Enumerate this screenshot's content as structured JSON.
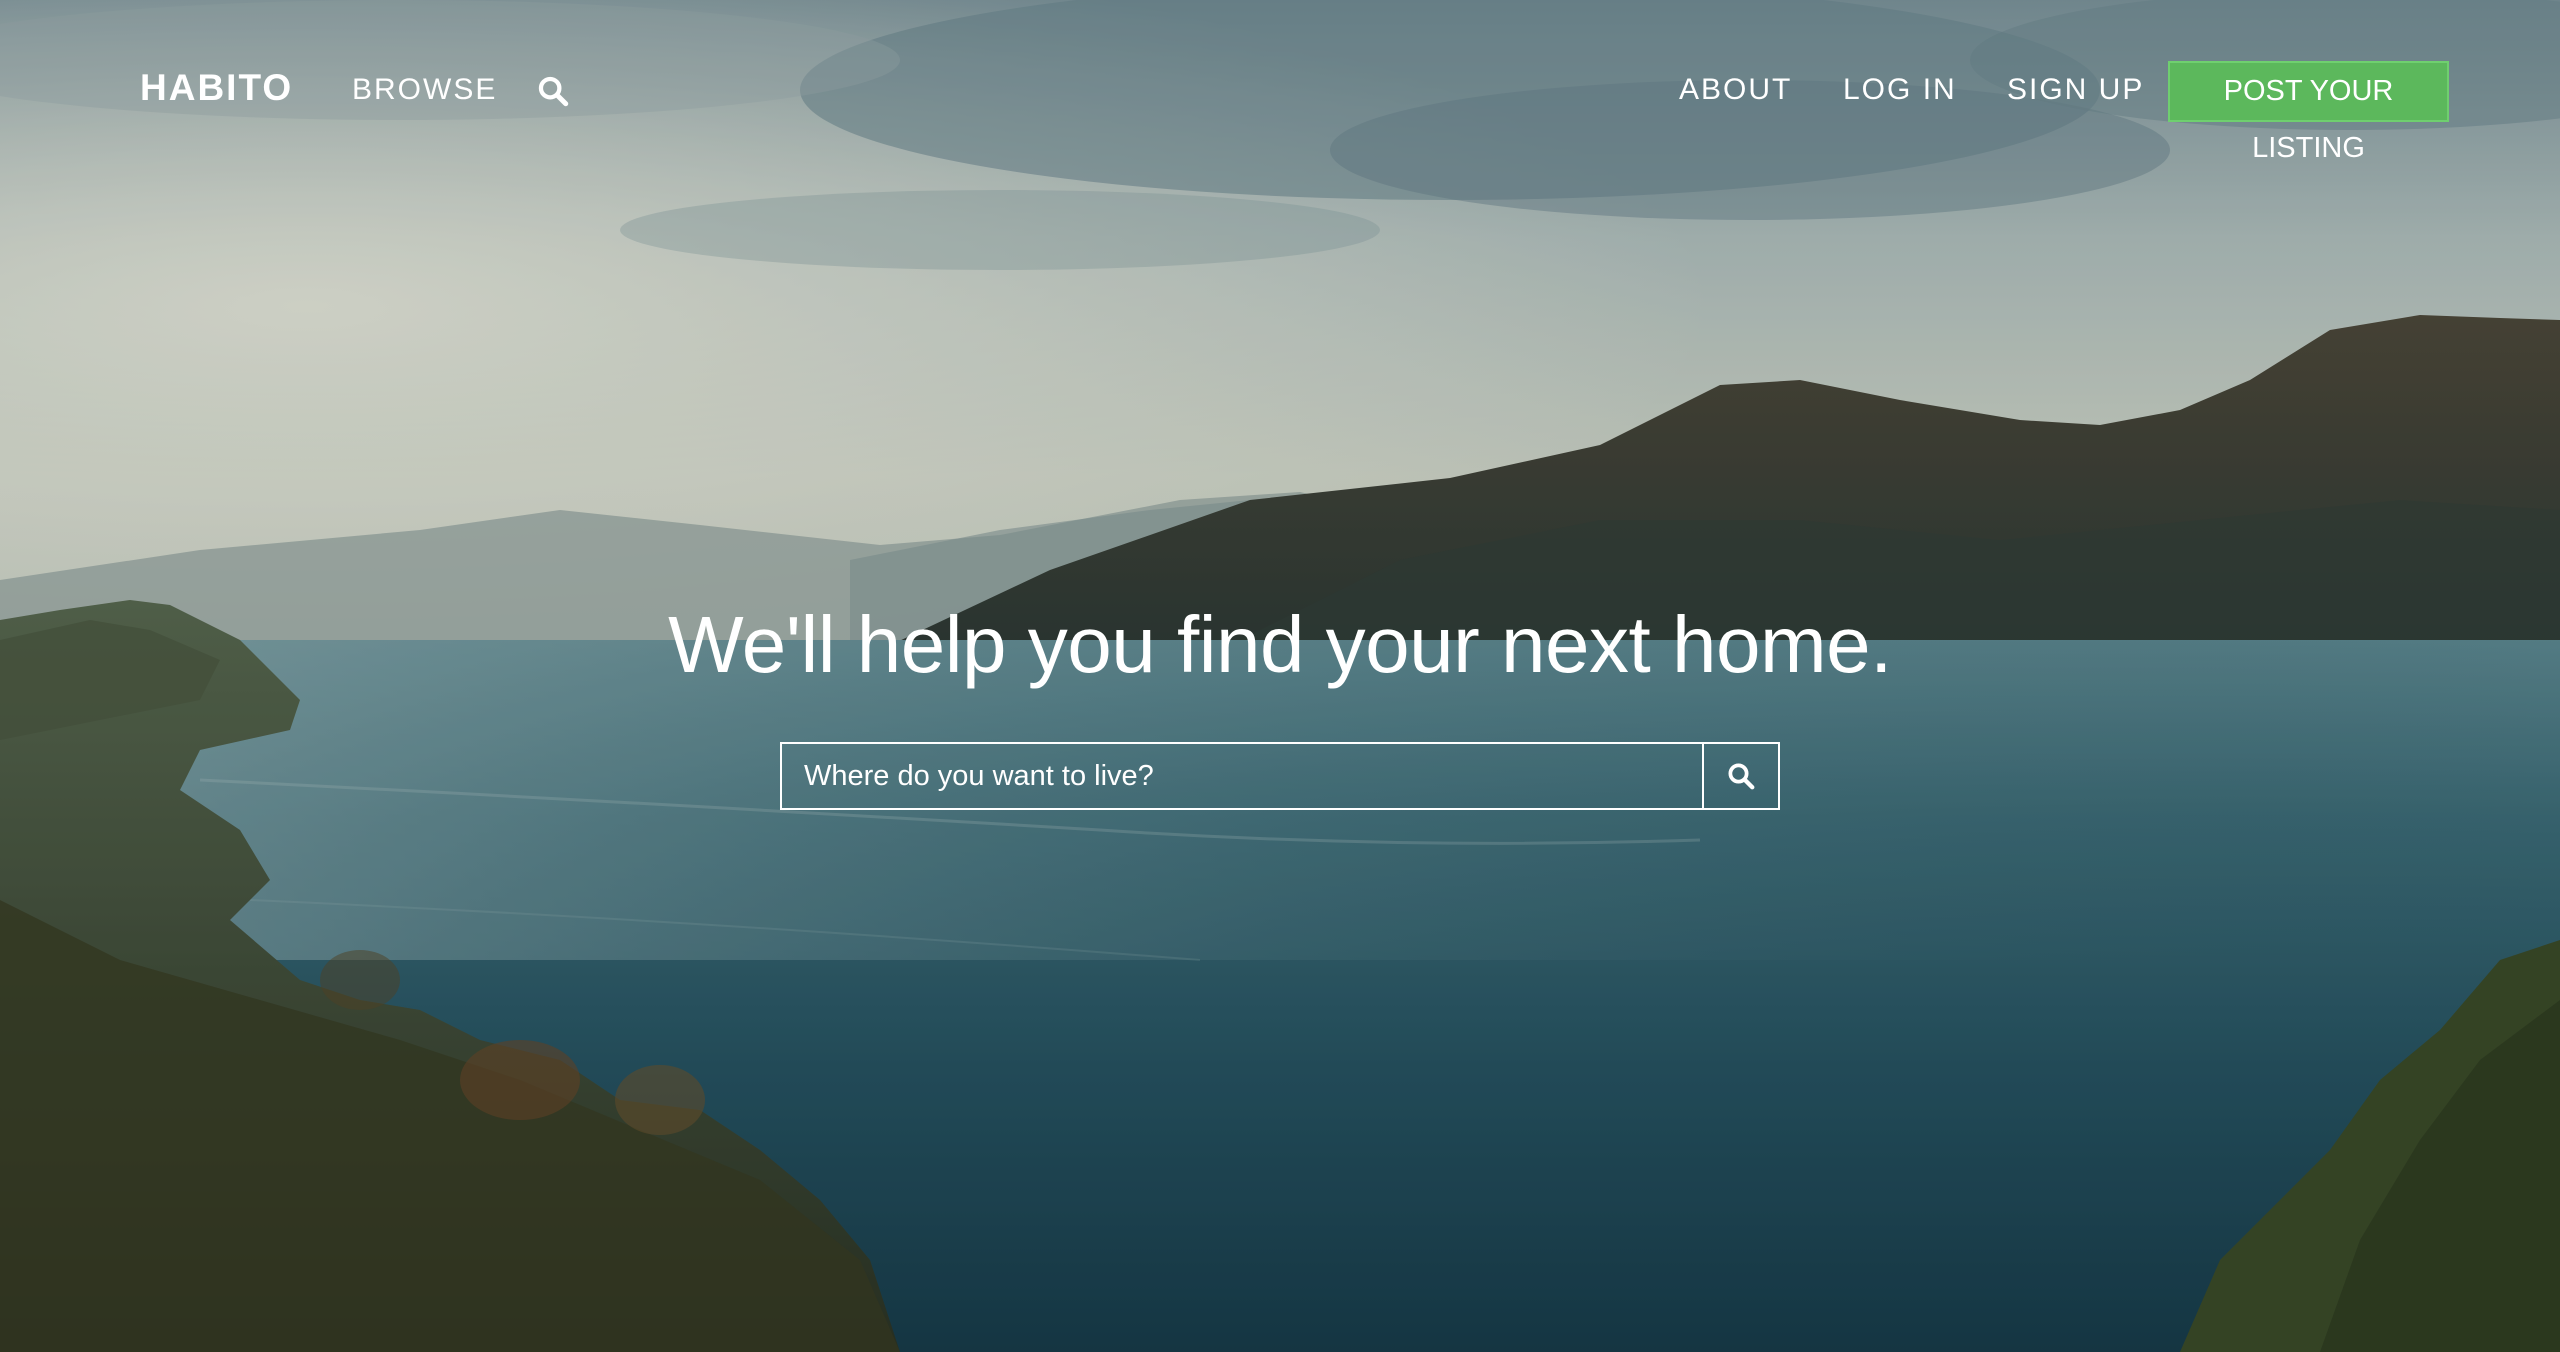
{
  "nav": {
    "brand": "HABITO",
    "browse_label": "BROWSE",
    "search_icon": "search-icon",
    "about_label": "ABOUT",
    "login_label": "LOG IN",
    "signup_label": "SIGN UP",
    "post_listing_label": "POST YOUR LISTING"
  },
  "hero": {
    "headline": "We'll help you find your next home.",
    "search": {
      "placeholder": "Where do you want to live?",
      "value": "",
      "button_icon": "search-icon"
    },
    "background": "lake-mountain-landscape-photo"
  },
  "colors": {
    "accent_green": "#5cb85c",
    "text": "#ffffff"
  }
}
